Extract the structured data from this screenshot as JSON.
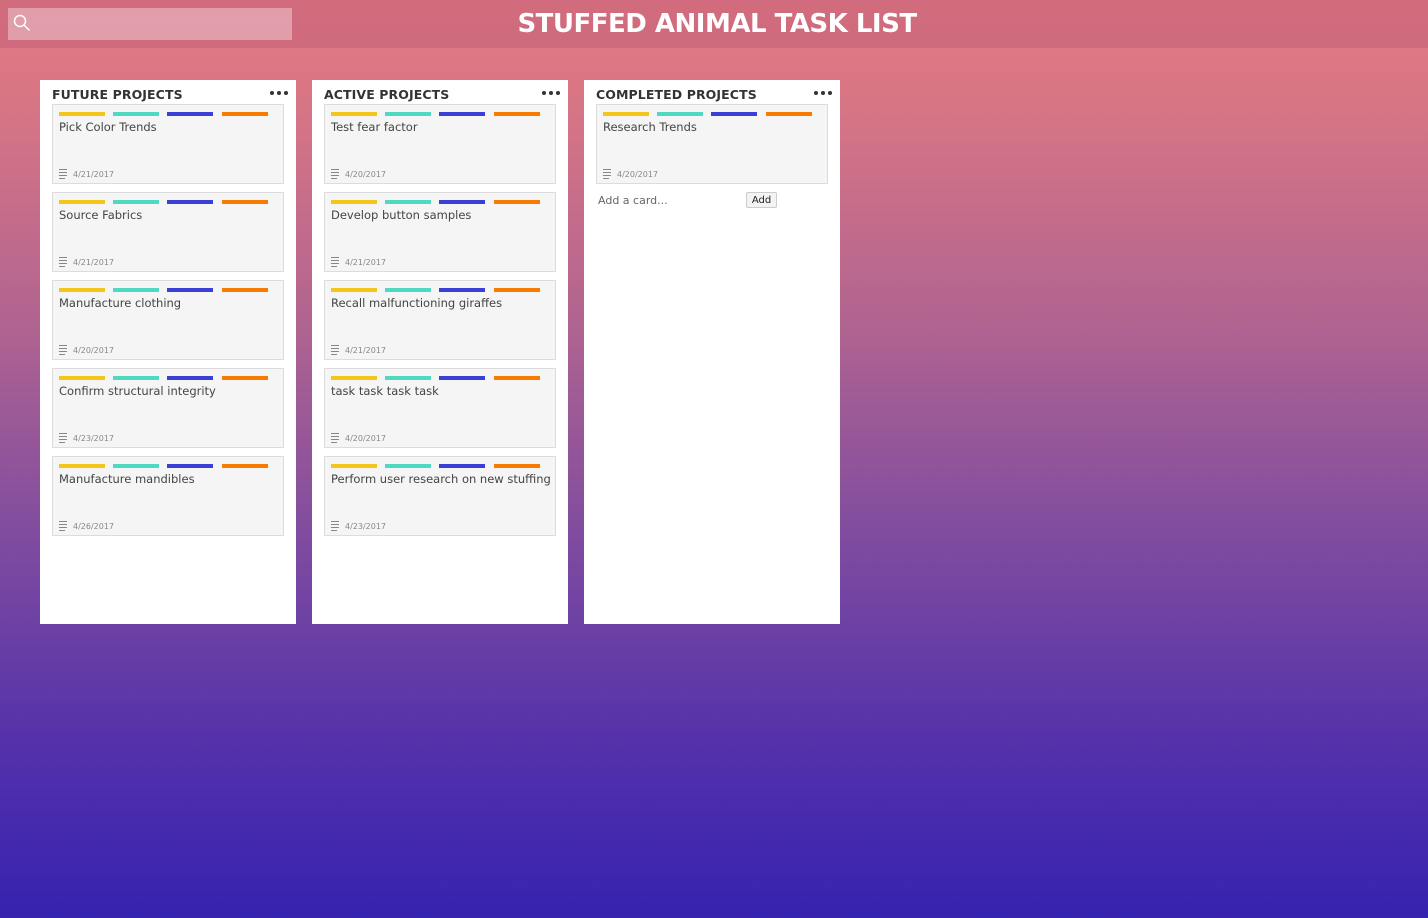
{
  "app": {
    "title": "STUFFED ANIMAL TASK LIST",
    "search_placeholder": ""
  },
  "label_colors": [
    "#f5c518",
    "#4dd9c2",
    "#3a3fd6",
    "#f57c00"
  ],
  "lists": [
    {
      "title": "FUTURE PROJECTS",
      "cards": [
        {
          "title": "Pick Color Trends",
          "date": "4/21/2017"
        },
        {
          "title": "Source Fabrics",
          "date": "4/21/2017"
        },
        {
          "title": "Manufacture clothing",
          "date": "4/20/2017"
        },
        {
          "title": "Confirm structural integrity",
          "date": "4/23/2017"
        },
        {
          "title": "Manufacture mandibles",
          "date": "4/26/2017"
        }
      ]
    },
    {
      "title": "ACTIVE PROJECTS",
      "cards": [
        {
          "title": "Test fear factor",
          "date": "4/20/2017"
        },
        {
          "title": "Develop button samples",
          "date": "4/21/2017"
        },
        {
          "title": "Recall malfunctioning giraffes",
          "date": "4/21/2017"
        },
        {
          "title": "task task task task",
          "date": "4/20/2017"
        },
        {
          "title": "Perform user research on new stuffing",
          "date": "4/23/2017"
        }
      ]
    },
    {
      "title": "COMPLETED PROJECTS",
      "cards": [
        {
          "title": "Research Trends",
          "date": "4/20/2017"
        }
      ],
      "add_card_placeholder": "Add a card...",
      "add_button_label": "Add"
    }
  ]
}
